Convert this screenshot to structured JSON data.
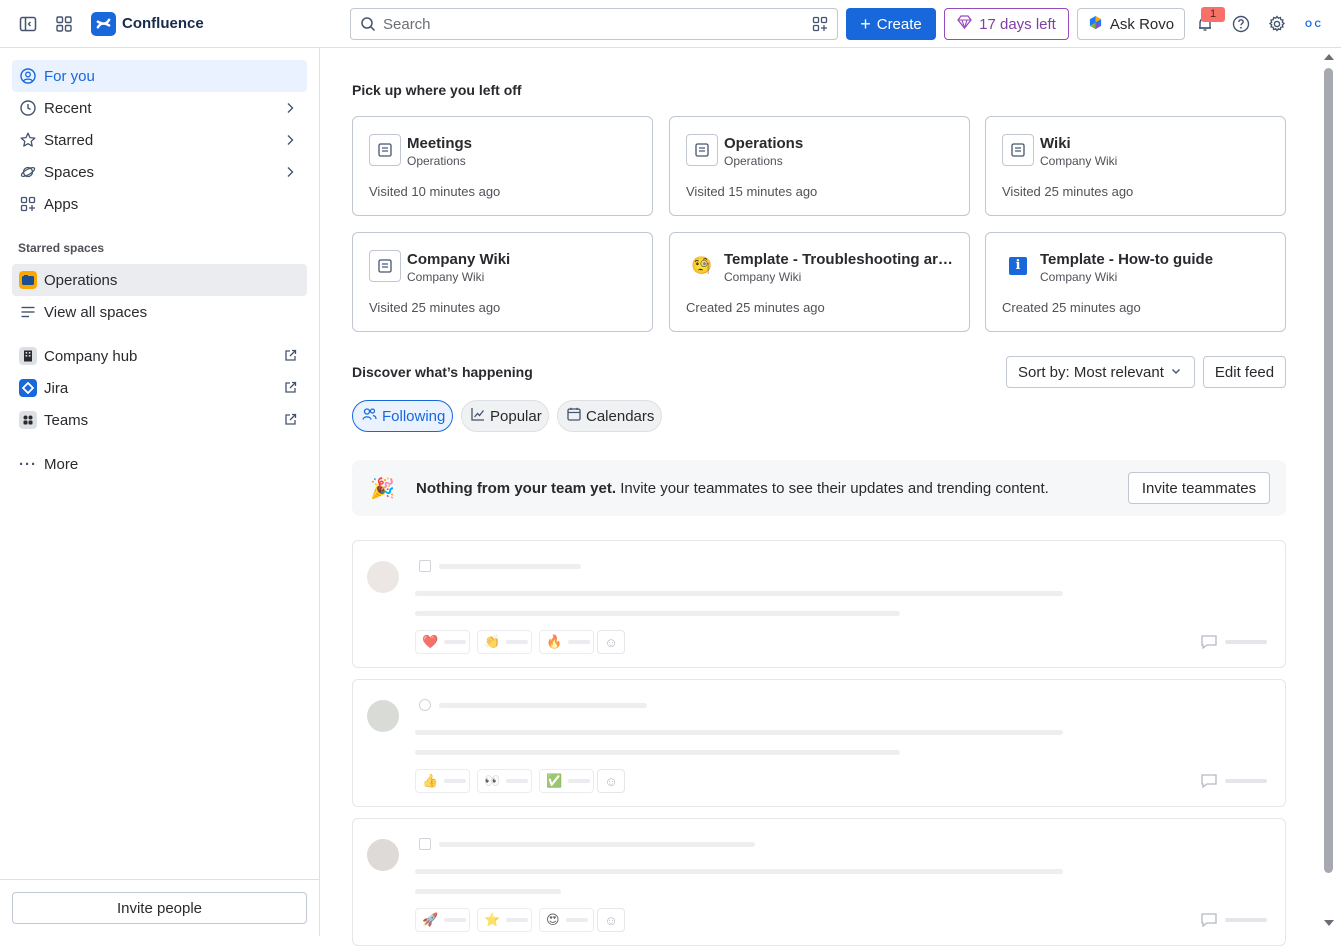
{
  "app": {
    "brand": "Confluence"
  },
  "header": {
    "search_placeholder": "Search",
    "create_label": "Create",
    "trial_label": "17 days left",
    "rovo_label": "Ask Rovo",
    "notification_count": "1",
    "avatar_text": "O C"
  },
  "sidebar": {
    "nav": [
      {
        "label": "For you"
      },
      {
        "label": "Recent"
      },
      {
        "label": "Starred"
      },
      {
        "label": "Spaces"
      },
      {
        "label": "Apps"
      }
    ],
    "starred_spaces_heading": "Starred spaces",
    "starred": [
      {
        "label": "Operations"
      },
      {
        "label": "View all spaces"
      }
    ],
    "links": [
      {
        "label": "Company hub"
      },
      {
        "label": "Jira"
      },
      {
        "label": "Teams"
      }
    ],
    "more_label": "More",
    "invite_label": "Invite people"
  },
  "main": {
    "recent_heading": "Pick up where you left off",
    "cards": [
      {
        "title": "Meetings",
        "space": "Operations",
        "visited": "Visited 10 minutes ago"
      },
      {
        "title": "Operations",
        "space": "Operations",
        "visited": "Visited 15 minutes ago"
      },
      {
        "title": "Wiki",
        "space": "Company Wiki",
        "visited": "Visited 25 minutes ago"
      },
      {
        "title": "Company Wiki",
        "space": "Company Wiki",
        "visited": "Visited 25 minutes ago"
      },
      {
        "title": "Template - Troubleshooting art...",
        "space": "Company Wiki",
        "visited": "Created 25 minutes ago"
      },
      {
        "title": "Template - How-to guide",
        "space": "Company Wiki",
        "visited": "Created 25 minutes ago"
      }
    ],
    "discover_heading": "Discover what’s happening",
    "sort_label": "Sort by: Most relevant",
    "edit_feed_label": "Edit feed",
    "tabs": [
      {
        "label": "Following"
      },
      {
        "label": "Popular"
      },
      {
        "label": "Calendars"
      }
    ],
    "banner": {
      "bold": "Nothing from your team yet.",
      "text": " Invite your teammates to see their updates and trending content.",
      "button": "Invite teammates"
    },
    "feed_reactions": [
      [
        "❤️",
        "👏",
        "🔥"
      ],
      [
        "👍",
        "👀",
        "✅"
      ],
      [
        "🚀",
        "⭐",
        "😍"
      ]
    ]
  },
  "colors": {
    "accent": "#1868db",
    "trial": "#803fa5",
    "badge": "#f87168"
  }
}
